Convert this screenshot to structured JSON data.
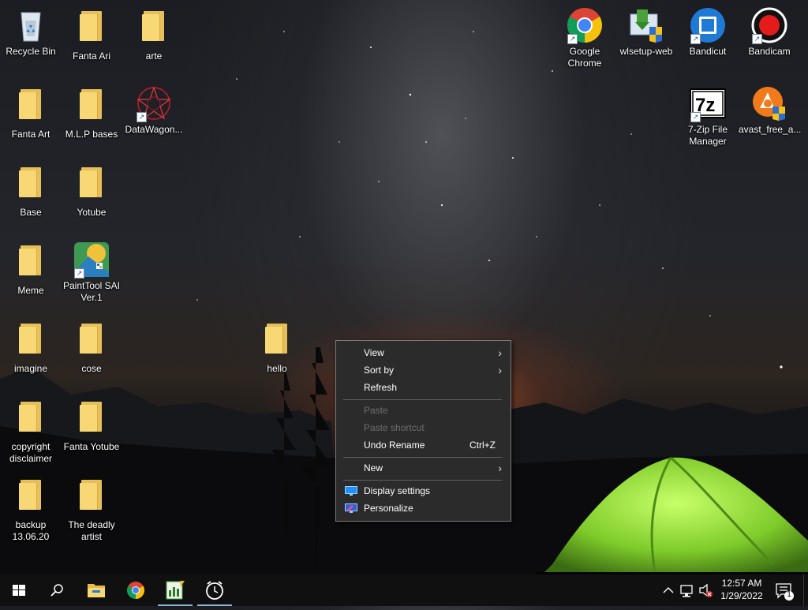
{
  "desktop": {
    "icons": [
      {
        "label": "Recycle Bin",
        "type": "recycle"
      },
      {
        "label": "Fanta Ari",
        "type": "folder"
      },
      {
        "label": "arte",
        "type": "folder"
      },
      {
        "label": "Fanta Art",
        "type": "folder"
      },
      {
        "label": "M.L.P bases",
        "type": "folder"
      },
      {
        "label": "DataWagon...",
        "type": "app-red-star"
      },
      {
        "label": "Base",
        "type": "folder"
      },
      {
        "label": "Yotube",
        "type": "folder"
      },
      {
        "label": "Meme",
        "type": "folder"
      },
      {
        "label": "PaintTool SAI Ver.1",
        "type": "app-paint"
      },
      {
        "label": "imagine",
        "type": "folder"
      },
      {
        "label": "cose",
        "type": "folder"
      },
      {
        "label": "copyright disclaimer",
        "type": "folder"
      },
      {
        "label": "Fanta Yotube",
        "type": "folder"
      },
      {
        "label": "backup 13.06.20",
        "type": "folder"
      },
      {
        "label": "The deadly artist",
        "type": "folder"
      },
      {
        "label": "hello",
        "type": "folder"
      },
      {
        "label": "Google Chrome",
        "type": "chrome"
      },
      {
        "label": "wlsetup-web",
        "type": "installer"
      },
      {
        "label": "Bandicut",
        "type": "bandicut"
      },
      {
        "label": "Bandicam",
        "type": "bandicam"
      },
      {
        "label": "7-Zip File Manager",
        "type": "7zip"
      },
      {
        "label": "avast_free_a...",
        "type": "avast"
      }
    ]
  },
  "context_menu": {
    "view": "View",
    "sort_by": "Sort by",
    "refresh": "Refresh",
    "paste": "Paste",
    "paste_shortcut": "Paste shortcut",
    "undo_rename": "Undo Rename",
    "undo_shortcut": "Ctrl+Z",
    "new": "New",
    "display_settings": "Display settings",
    "personalize": "Personalize",
    "submenu_arrow": "›"
  },
  "taskbar": {
    "time": "12:57 AM",
    "date": "1/29/2022",
    "notification_count": "1",
    "pinned": [
      "start-icon",
      "search-icon",
      "file-explorer-icon",
      "chrome-icon",
      "paint-app-icon",
      "alarm-clock-icon"
    ]
  },
  "colors": {
    "menu_bg": "#2b2b2b",
    "taskbar_bg": "#101010",
    "folder_yellow": "#f8d775",
    "tent_green": "#8bd12a"
  }
}
